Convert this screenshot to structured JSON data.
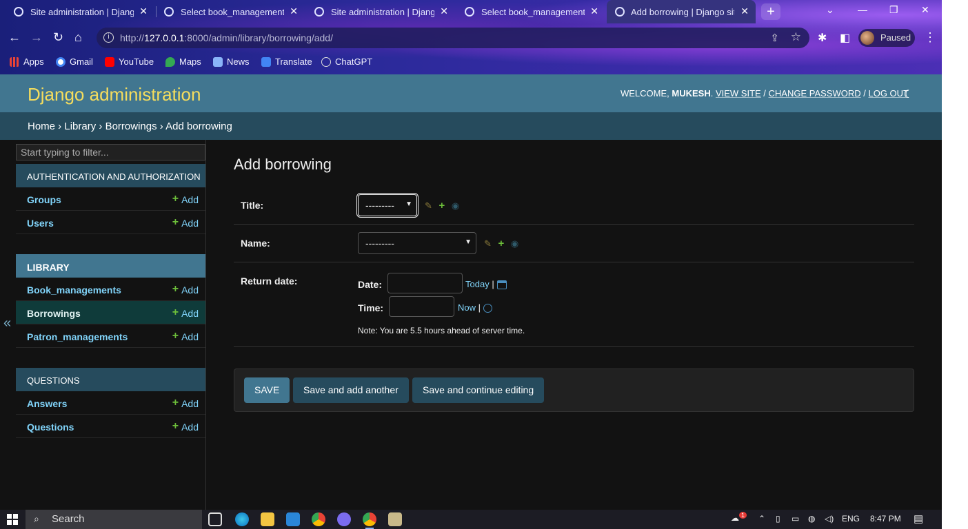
{
  "browser": {
    "tabs": [
      {
        "title": "Site administration | Django"
      },
      {
        "title": "Select book_management to"
      },
      {
        "title": "Site administration | Django"
      },
      {
        "title": "Select book_management to"
      },
      {
        "title": "Add borrowing | Django site"
      }
    ],
    "url_host": "127.0.0.1",
    "url_prefix": "http://",
    "url_rest": ":8000/admin/library/borrowing/add/",
    "profile_label": "Paused",
    "bookmarks": [
      "Apps",
      "Gmail",
      "YouTube",
      "Maps",
      "News",
      "Translate",
      "ChatGPT"
    ]
  },
  "header": {
    "brand": "Django administration",
    "welcome": "WELCOME,",
    "username": "MUKESH",
    "view_site": "VIEW SITE",
    "change_password": "CHANGE PASSWORD",
    "log_out": "LOG OUT"
  },
  "breadcrumbs": {
    "home": "Home",
    "app": "Library",
    "model": "Borrowings",
    "current": "Add borrowing"
  },
  "sidebar": {
    "filter_placeholder": "Start typing to filter...",
    "toggle": "«",
    "add_label": "Add",
    "modules": [
      {
        "caption": "AUTHENTICATION AND AUTHORIZATION",
        "models": [
          "Groups",
          "Users"
        ]
      },
      {
        "caption": "LIBRARY",
        "models": [
          "Book_managements",
          "Borrowings",
          "Patron_managements"
        ]
      },
      {
        "caption": "QUESTIONS",
        "models": [
          "Answers",
          "Questions"
        ]
      }
    ]
  },
  "form": {
    "page_title": "Add borrowing",
    "title_label": "Title:",
    "title_value": "---------",
    "name_label": "Name:",
    "name_value": "---------",
    "return_date_label": "Return date:",
    "date_label": "Date:",
    "today_link": "Today",
    "time_label": "Time:",
    "now_link": "Now",
    "note": "Note: You are 5.5 hours ahead of server time."
  },
  "submit": {
    "save": "SAVE",
    "save_add_another": "Save and add another",
    "save_continue": "Save and continue editing"
  },
  "taskbar": {
    "search": "Search",
    "lang": "ENG",
    "time": "8:47 PM",
    "notification_count": "1"
  },
  "colors": {
    "header": "#417690",
    "breadcrumbs": "#264b5d",
    "brand": "#f5dd5d",
    "link": "#81d4fa",
    "add_plus": "#6dbf3a",
    "background": "#121212"
  }
}
